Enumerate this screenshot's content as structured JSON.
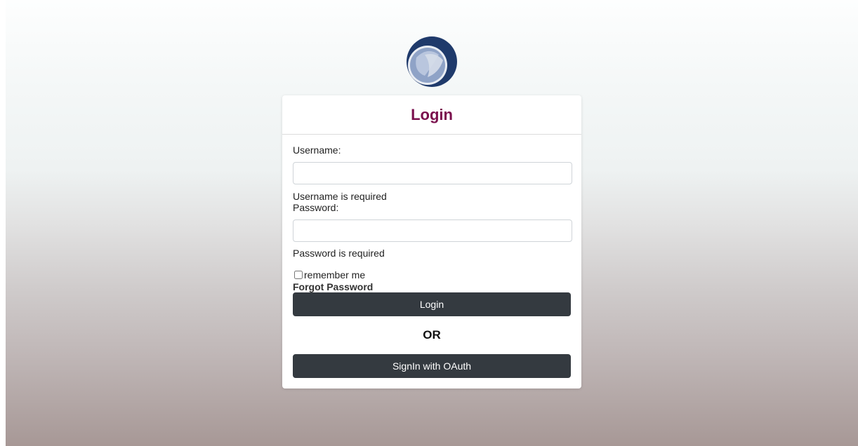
{
  "login": {
    "title": "Login",
    "username_label": "Username:",
    "username_value": "",
    "username_error": "Username is required",
    "password_label": "Password:",
    "password_value": "",
    "password_error": "Password is required",
    "remember_label": "remember me",
    "remember_checked": false,
    "forgot_link": "Forgot Password",
    "login_button": "Login",
    "or_text": "OR",
    "oauth_button": "SignIn with OAuth"
  },
  "colors": {
    "title": "#7a0f4d",
    "button_bg": "#343a40",
    "logo_dark": "#1f3a6b",
    "logo_light": "#9fb0cf"
  },
  "icons": {
    "logo": "circular-logo"
  }
}
